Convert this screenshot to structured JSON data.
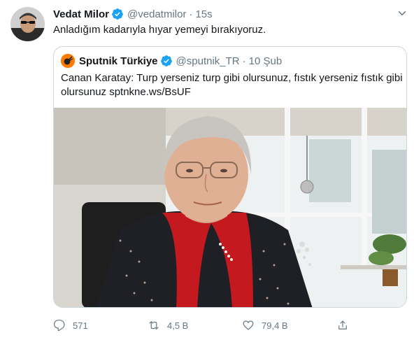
{
  "tweet": {
    "author_name": "Vedat Milor",
    "author_handle": "@vedatmilor",
    "separator": "·",
    "time": "15s",
    "text": "Anladığım kadarıyla hıyar yemeyi bırakıyoruz."
  },
  "quote": {
    "author_name": "Sputnik Türkiye",
    "author_handle": "@sputnik_TR",
    "separator": "·",
    "date": "10 Şub",
    "text_line1": "Canan Karatay: Turp yerseniz turp gibi olursunuz, fıstık yerseniz fıstık gibi",
    "text_line2": "olursunuz sptnkne.ws/BsUF"
  },
  "actions": {
    "reply_count": "571",
    "retweet_count": "4,5 B",
    "like_count": "79,4 B"
  },
  "colors": {
    "verified": "#1da1f2",
    "secondary_text": "#657786",
    "sputnik_orange": "#ff7a00"
  }
}
